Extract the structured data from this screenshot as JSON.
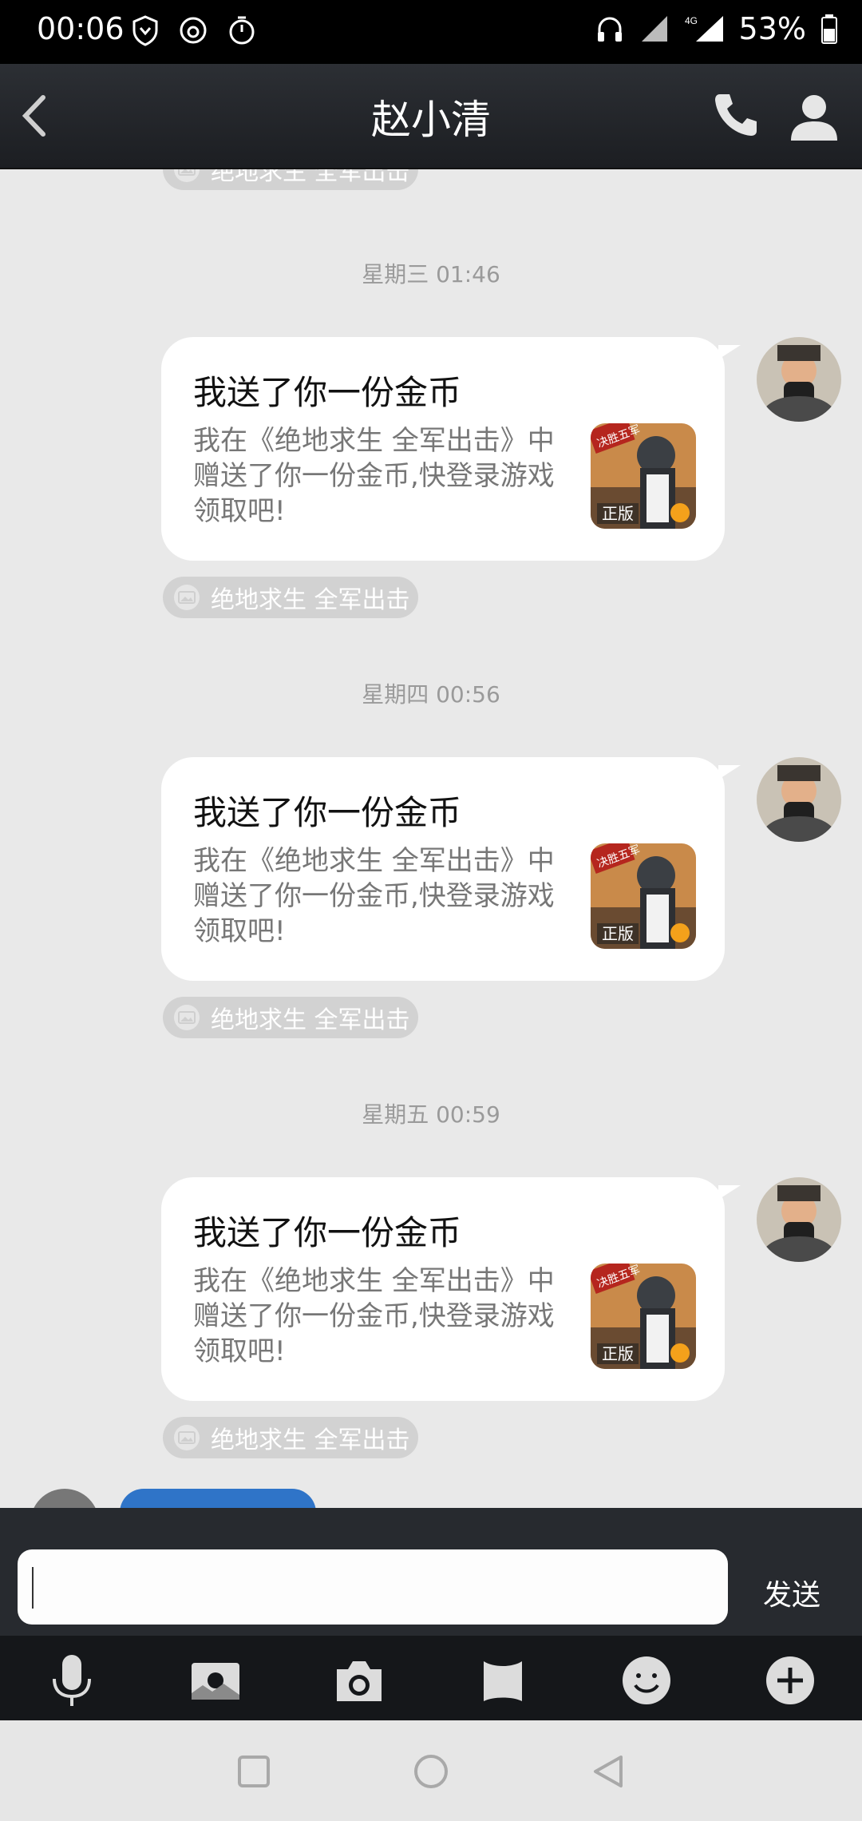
{
  "status_bar": {
    "time": "00:06",
    "battery": "53%",
    "network": "4G"
  },
  "header": {
    "title": "赵小清"
  },
  "messages": [
    {
      "timestamp": "星期三 01:46",
      "card_title": "我送了你一份金币",
      "card_desc": "我在《绝地求生 全军出击》中赠送了你一份金币,快登录游戏领取吧!",
      "game_badge": "正版",
      "game_banner": "决胜五军",
      "source": "绝地求生 全军出击"
    },
    {
      "timestamp": "星期四 00:56",
      "card_title": "我送了你一份金币",
      "card_desc": "我在《绝地求生 全军出击》中赠送了你一份金币,快登录游戏领取吧!",
      "game_badge": "正版",
      "game_banner": "决胜五军",
      "source": "绝地求生 全军出击"
    },
    {
      "timestamp": "星期五 00:59",
      "card_title": "我送了你一份金币",
      "card_desc": "我在《绝地求生 全军出击》中赠送了你一份金币,快登录游戏领取吧!",
      "game_badge": "正版",
      "game_banner": "决胜五军",
      "source": "绝地求生 全军出击"
    }
  ],
  "top_source": "绝地求生 全军出击",
  "input": {
    "value": "",
    "send_label": "发送"
  },
  "toolbar": [
    "microphone-icon",
    "album-icon",
    "camera-icon",
    "folder-icon",
    "emoji-icon",
    "plus-icon"
  ],
  "colors": {
    "titlebar": "#25282d",
    "chat_bg": "#e9e9e9",
    "bubble": "#ffffff",
    "tag": "#d2d2d2"
  }
}
